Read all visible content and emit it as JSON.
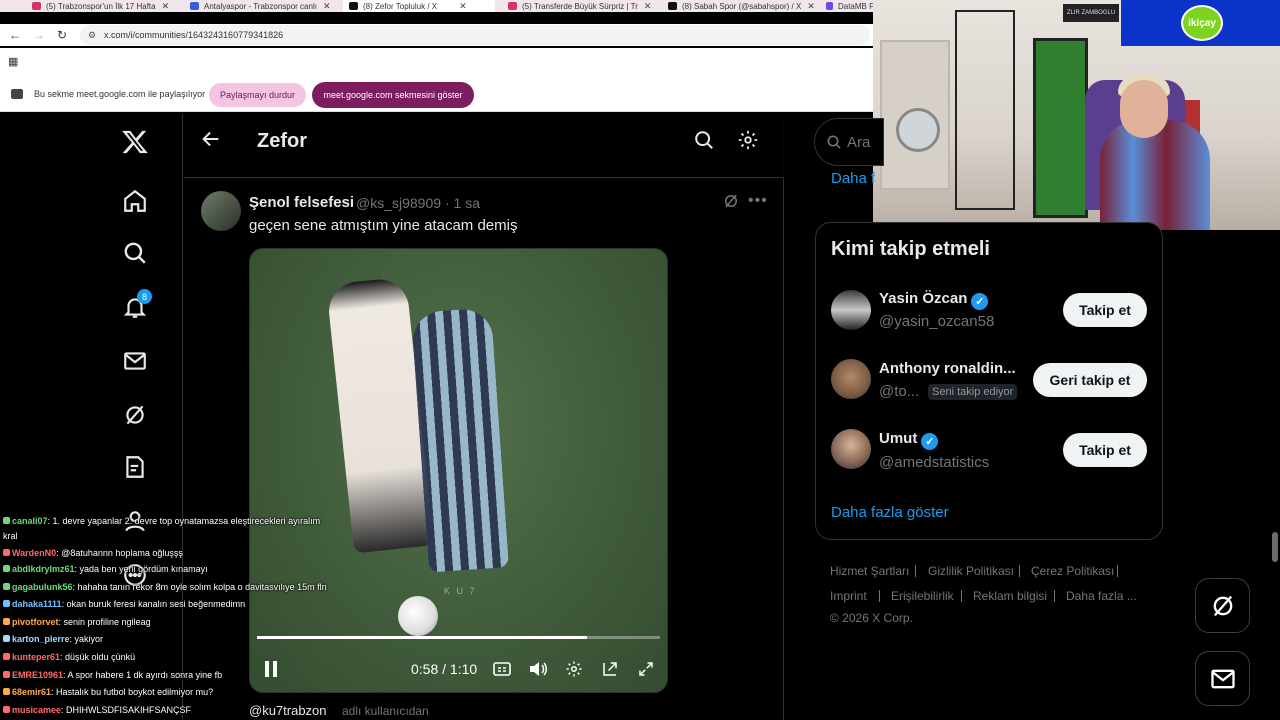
{
  "browser": {
    "tabs": [
      {
        "label": "(5) Trabzonspor'un İlk 17 Hafta",
        "color": "#d6336c",
        "active": false
      },
      {
        "label": "Antalyaspor - Trabzonspor canlı",
        "color": "#3b5bdb",
        "active": false
      },
      {
        "label": "(8) Zefor Topluluk / X",
        "color": "#111111",
        "active": true
      },
      {
        "label": "(5) Transferde Büyük Sürpriz | Tr",
        "color": "#d6336c",
        "active": false
      },
      {
        "label": "(8) Sabah Spor (@sabahspor) / X",
        "color": "#111111",
        "active": false
      },
      {
        "label": "DataMB F",
        "color": "#7048e8",
        "active": false
      }
    ],
    "url": "x.com/i/communities/1643243160779341826",
    "share_text": "Bu sekme meet.google.com ile paylaşılıyor",
    "stop_share_label": "Paylaşmayı durdur",
    "show_tab_label": "meet.google.com sekmesini göster"
  },
  "nav": {
    "notification_count": "8",
    "items": [
      "x-logo-icon",
      "home-icon",
      "search-icon",
      "bell-icon",
      "mail-icon",
      "grok-icon",
      "drafts-icon",
      "profile-icon",
      "more-icon"
    ]
  },
  "header": {
    "title": "Zefor"
  },
  "post": {
    "author_name": "Şenol felsefesi",
    "author_handle": "@ks_sj98909",
    "time": "· 1 sa",
    "text": "geçen sene atmıştım yine atacam demiş",
    "watermark": "K U 7",
    "video_time": "0:58 / 1:10",
    "progress": 0.82,
    "quoted_handle": "@ku7trabzon",
    "quoted_rest": "adlı kullanıcıdan"
  },
  "sidebar": {
    "search_placeholder": "Ara",
    "daha_top": "Daha f",
    "wtf_title": "Kimi takip etmeli",
    "suggestions": [
      {
        "name": "Yasin Özcan",
        "handle": "@yasin_ozcan58",
        "verified": true,
        "button": "Takip et",
        "follows_you": ""
      },
      {
        "name": "Anthony ronaldin...",
        "handle": "@to...",
        "verified": false,
        "button": "Geri takip et",
        "follows_you": "Seni takip ediyor"
      },
      {
        "name": "Umut",
        "handle": "@amedstatistics",
        "verified": true,
        "button": "Takip et",
        "follows_you": ""
      }
    ],
    "show_more": "Daha fazla göster",
    "footer": [
      "Hizmet Şartları",
      "Gizlilik Politikası",
      "Çerez Politikası",
      "Imprint",
      "Erişilebilirlik",
      "Reklam bilgisi",
      "Daha fazla ...",
      "© 2026 X Corp."
    ]
  },
  "stream": {
    "logo_text": "ikiçay",
    "sign_text": "ZLIR ZAMBOGLU"
  },
  "chat": [
    {
      "user": "canali07",
      "color": "#69db7c",
      "text": ": 1. devre yapanlar 2. devre top oynatamazsa eleştirecekleri ayıralım"
    },
    {
      "user": "",
      "color": "",
      "text": "kral"
    },
    {
      "user": "WardenN0",
      "color": "#ff6b6b",
      "text": ": @8atuhannn hoplama oğluşşş"
    },
    {
      "user": "abdlkdrylmz61",
      "color": "#69db7c",
      "text": ": yada ben yeni gördüm kınamayı"
    },
    {
      "user": "gagabulunk56",
      "color": "#69db7c",
      "text": ": hahaha tanın rekor 8m oyle solım kolpa o davitasvılıye 15m fln"
    },
    {
      "user": "dahaka1111",
      "color": "#74c0fc",
      "text": ": okan buruk feresi kanalın sesi beğenmedimn"
    },
    {
      "user": "pivotforvet",
      "color": "#ffa94d",
      "text": ": senin profiline ngileag"
    },
    {
      "user": "karton_pierre",
      "color": "#a5d8ff",
      "text": ": yakiyor"
    },
    {
      "user": "kunteper61",
      "color": "#ff6b6b",
      "text": ": düşük oldu çünkü"
    },
    {
      "user": "EMRE10961",
      "color": "#ff6b6b",
      "text": ": A spor habere 1 dk ayırdı sonra yine fb"
    },
    {
      "user": "68emir61",
      "color": "#ffa94d",
      "text": ": Hastalık bu futbol boykot edilmiyor mu?"
    },
    {
      "user": "musicamee",
      "color": "#ff6b6b",
      "text": ": DHIHWLSDFISAKIHFSANÇSF"
    }
  ]
}
